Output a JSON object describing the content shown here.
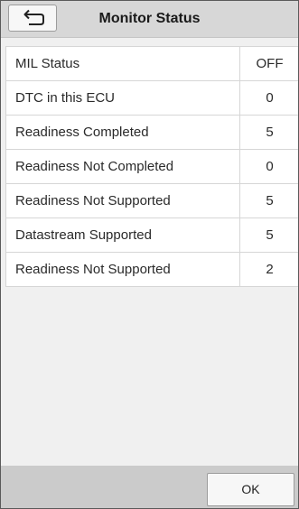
{
  "header": {
    "title": "Monitor Status",
    "back_icon": "return-arrow-icon"
  },
  "rows": [
    {
      "label": "MIL Status",
      "value": "OFF"
    },
    {
      "label": "DTC in this ECU",
      "value": "0"
    },
    {
      "label": "Readiness Completed",
      "value": "5"
    },
    {
      "label": "Readiness Not Completed",
      "value": "0"
    },
    {
      "label": "Readiness Not Supported",
      "value": "5"
    },
    {
      "label": "Datastream Supported",
      "value": "5"
    },
    {
      "label": "Readiness Not Supported",
      "value": "2"
    }
  ],
  "footer": {
    "ok_label": "OK"
  },
  "colors": {
    "header_bg": "#d7d7d7",
    "content_bg": "#f0f0f0",
    "footer_bg": "#cbcbcb",
    "table_bg": "#ffffff"
  }
}
